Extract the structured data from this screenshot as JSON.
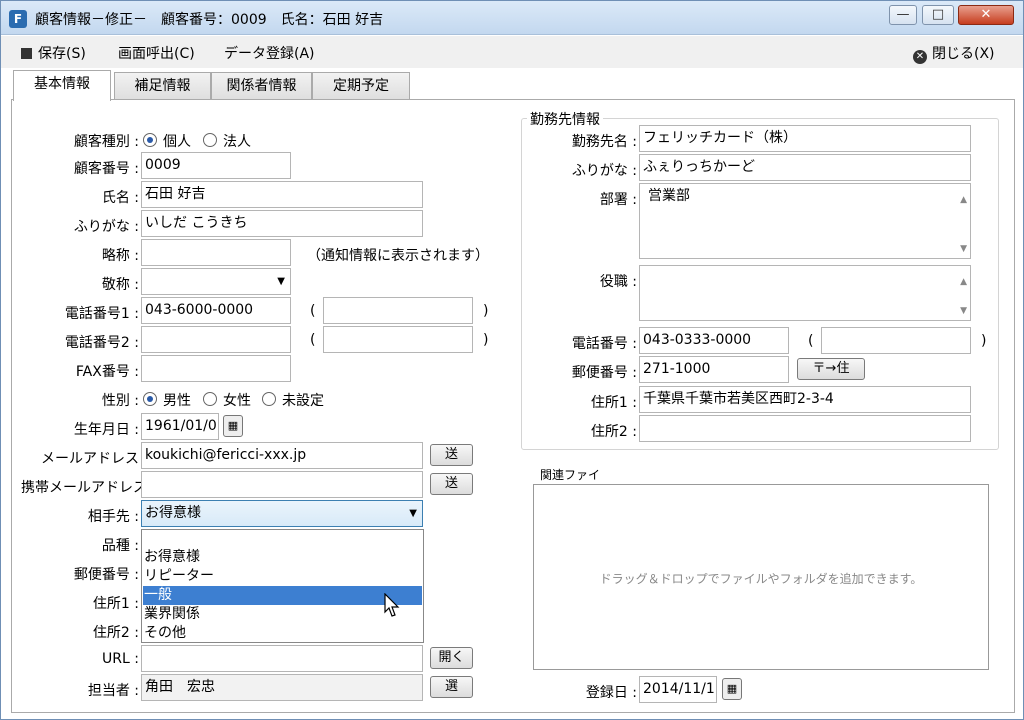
{
  "window": {
    "title": "顧客情報－修正－　顧客番号：0009　氏名：石田 好吉",
    "minimize": "—",
    "maximize": "□",
    "close": "✕"
  },
  "menu": {
    "save": "保存(S)",
    "screen_call": "画面呼出(C)",
    "data_register": "データ登録(A)",
    "close": "閉じる(X)"
  },
  "tabs": [
    "基本情報",
    "補足情報",
    "関係者情報",
    "定期予定"
  ],
  "basic": {
    "customer_type_label": "顧客種別 :",
    "customer_type_options": [
      "個人",
      "法人"
    ],
    "customer_no_label": "顧客番号 :",
    "customer_no": "0009",
    "name_label": "氏名 :",
    "name": "石田 好吉",
    "furigana_label": "ふりがな :",
    "furigana": "いしだ こうきち",
    "abbr_label": "略称 :",
    "abbr": "",
    "abbr_note": "（通知情報に表示されます）",
    "honorific_label": "敬称 :",
    "honorific": "",
    "phone1_label": "電話番号1 :",
    "phone1": "043-6000-0000",
    "phone1_note": "",
    "phone2_label": "電話番号2 :",
    "phone2": "",
    "phone2_note": "",
    "paren_open": "(",
    "paren_close": ")",
    "fax_label": "FAX番号 :",
    "fax": "",
    "gender_label": "性別 :",
    "gender_options": [
      "男性",
      "女性",
      "未設定"
    ],
    "birthday_label": "生年月日 :",
    "birthday": "1961/01/0",
    "email_label": "メールアドレス",
    "email": "koukichi@fericci-xxx.jp",
    "send": "送",
    "mobile_email_label": "携帯メールアドレス",
    "mobile_email": "",
    "partner_label": "相手先 :",
    "partner": "お得意様",
    "partner_options": [
      "お得意様",
      "リピーター",
      "一般",
      "業界関係",
      "その他"
    ],
    "kind_label": "品種 :",
    "postal_label": "郵便番号 :",
    "addr1_label": "住所1 :",
    "addr2_label": "住所2 :",
    "url_label": "URL :",
    "url": "",
    "open": "開く",
    "staff_label": "担当者 :",
    "staff": "角田　宏忠",
    "select": "選"
  },
  "work": {
    "legend": "勤務先情報",
    "company_label": "勤務先名 :",
    "company": "フェリッチカード（株）",
    "furigana_label": "ふりがな :",
    "furigana": "ふぇりっちかーど",
    "dept_label": "部署 :",
    "dept": "営業部",
    "title_label": "役職 :",
    "title": "",
    "phone_label": "電話番号 :",
    "phone": "043-0333-0000",
    "phone_note": "",
    "postal_label": "郵便番号 :",
    "postal": "271-1000",
    "postal_btn": "〒→住",
    "addr1_label": "住所1 :",
    "addr1": "千葉県千葉市若美区西町2-3-4",
    "addr2_label": "住所2 :",
    "addr2": ""
  },
  "files": {
    "legend": "関連ファイ",
    "hint": "ドラッグ＆ドロップでファイルやフォルダを追加できます。"
  },
  "reg": {
    "label": "登録日 :",
    "date": "2014/11/1"
  }
}
